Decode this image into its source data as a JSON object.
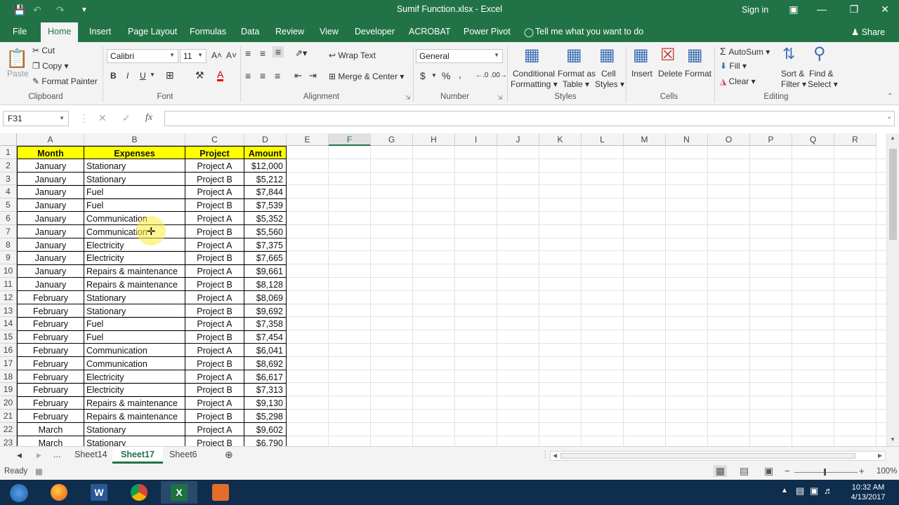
{
  "titlebar": {
    "title": "Sumif Function.xlsx  -  Excel",
    "sign_in": "Sign in"
  },
  "tabs": [
    "File",
    "Home",
    "Insert",
    "Page Layout",
    "Formulas",
    "Data",
    "Review",
    "View",
    "Developer",
    "ACROBAT",
    "Power Pivot"
  ],
  "tell_me": "Tell me what you want to do",
  "share": "Share",
  "ribbon": {
    "clipboard": {
      "paste": "Paste",
      "cut": "Cut",
      "copy": "Copy",
      "format_painter": "Format Painter",
      "label": "Clipboard"
    },
    "font": {
      "name": "Calibri",
      "size": "11",
      "label": "Font",
      "bold": "B",
      "italic": "I",
      "underline": "U"
    },
    "alignment": {
      "wrap_text": "Wrap Text",
      "merge_center": "Merge & Center",
      "label": "Alignment"
    },
    "number": {
      "format": "General",
      "currency": "$",
      "percent": "%",
      "comma": ",",
      "label": "Number"
    },
    "styles": {
      "conditional_formatting_1": "Conditional",
      "conditional_formatting_2": "Formatting",
      "format_as_table_1": "Format as",
      "format_as_table_2": "Table",
      "cell_styles_1": "Cell",
      "cell_styles_2": "Styles",
      "label": "Styles"
    },
    "cells": {
      "insert": "Insert",
      "delete": "Delete",
      "format": "Format",
      "label": "Cells"
    },
    "editing": {
      "autosum": "AutoSum",
      "fill": "Fill",
      "clear": "Clear",
      "sort_filter_1": "Sort &",
      "sort_filter_2": "Filter",
      "find_select_1": "Find &",
      "find_select_2": "Select",
      "label": "Editing"
    }
  },
  "formula_bar": {
    "name_box": "F31",
    "fx": "fx",
    "formula": ""
  },
  "columns": [
    "A",
    "B",
    "C",
    "D",
    "E",
    "F",
    "G",
    "H",
    "I",
    "J",
    "K",
    "L",
    "M",
    "N",
    "O",
    "P",
    "Q",
    "R"
  ],
  "selected_column": "F",
  "table": {
    "headers": [
      "Month",
      "Expenses",
      "Project",
      "Amount"
    ],
    "rows": [
      [
        "January",
        "Stationary",
        "Project A",
        "$12,000"
      ],
      [
        "January",
        "Stationary",
        "Project B",
        "$5,212"
      ],
      [
        "January",
        "Fuel",
        "Project A",
        "$7,844"
      ],
      [
        "January",
        "Fuel",
        "Project B",
        "$7,539"
      ],
      [
        "January",
        "Communication",
        "Project A",
        "$5,352"
      ],
      [
        "January",
        "Communication",
        "Project B",
        "$5,560"
      ],
      [
        "January",
        "Electricity",
        "Project A",
        "$7,375"
      ],
      [
        "January",
        "Electricity",
        "Project B",
        "$7,665"
      ],
      [
        "January",
        "Repairs & maintenance",
        "Project A",
        "$9,661"
      ],
      [
        "January",
        "Repairs & maintenance",
        "Project B",
        "$8,128"
      ],
      [
        "February",
        "Stationary",
        "Project A",
        "$8,069"
      ],
      [
        "February",
        "Stationary",
        "Project B",
        "$9,692"
      ],
      [
        "February",
        "Fuel",
        "Project A",
        "$7,358"
      ],
      [
        "February",
        "Fuel",
        "Project B",
        "$7,454"
      ],
      [
        "February",
        "Communication",
        "Project A",
        "$6,041"
      ],
      [
        "February",
        "Communication",
        "Project B",
        "$8,692"
      ],
      [
        "February",
        "Electricity",
        "Project A",
        "$6,617"
      ],
      [
        "February",
        "Electricity",
        "Project B",
        "$7,313"
      ],
      [
        "February",
        "Repairs & maintenance",
        "Project A",
        "$9,130"
      ],
      [
        "February",
        "Repairs & maintenance",
        "Project B",
        "$5,298"
      ],
      [
        "March",
        "Stationary",
        "Project A",
        "$9,602"
      ],
      [
        "March",
        "Stationary",
        "Project B",
        "$6,790"
      ]
    ]
  },
  "sheet_tabs": [
    "Sheet14",
    "Sheet17",
    "Sheet6"
  ],
  "active_sheet": "Sheet17",
  "sheet_ellipsis": "...",
  "status": {
    "ready": "Ready",
    "zoom": "100%"
  },
  "clock": {
    "time": "10:32 AM",
    "date": "4/13/2017"
  },
  "colors": {
    "excel_green": "#217346",
    "header_fill": "#ffff00"
  }
}
